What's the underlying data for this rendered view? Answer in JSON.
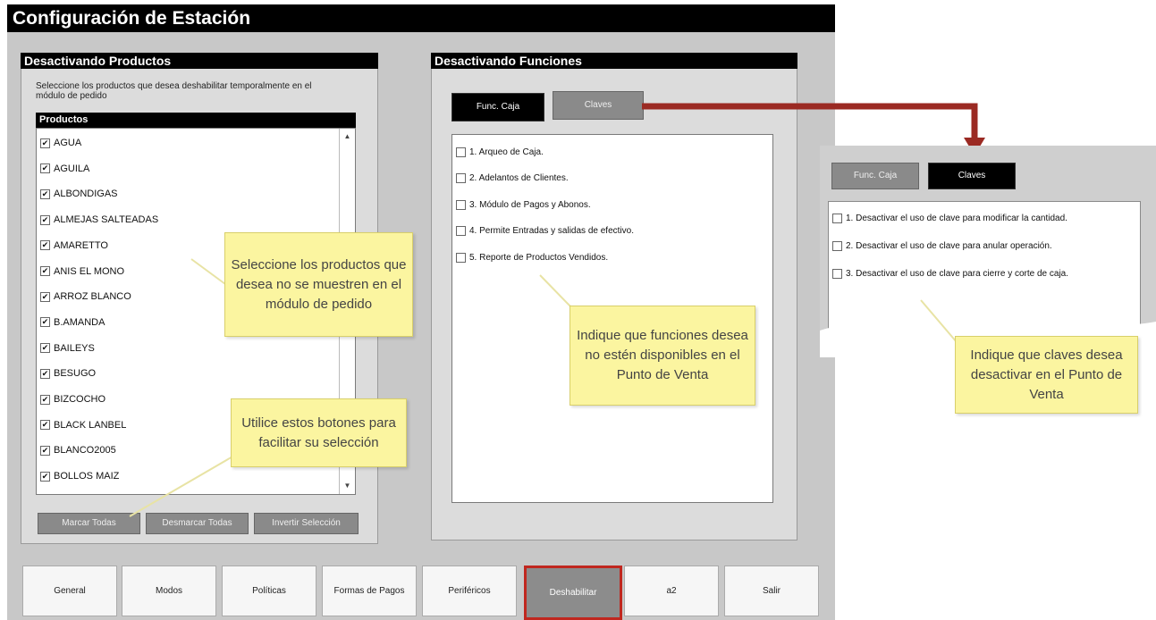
{
  "window": {
    "title": "Configuración de Estación"
  },
  "products_panel": {
    "header": "Desactivando Productos",
    "description": "Seleccione los productos que desea deshabilitar temporalmente en el módulo de pedido",
    "list_header": "Productos",
    "items": [
      "AGUA",
      "AGUILA",
      "ALBONDIGAS",
      "ALMEJAS SALTEADAS",
      "AMARETTO",
      "ANIS EL MONO",
      "ARROZ BLANCO",
      "B.AMANDA",
      "BAILEYS",
      "BESUGO",
      "BIZCOCHO",
      "BLACK LANBEL",
      "BLANCO2005",
      "BOLLOS MAIZ"
    ],
    "buttons": {
      "mark_all": "Marcar Todas",
      "unmark_all": "Desmarcar Todas",
      "invert": "Invertir Selección"
    }
  },
  "functions_panel": {
    "header": "Desactivando Funciones",
    "tab_caja": "Func. Caja",
    "tab_claves": "Claves",
    "items": [
      "1. Arqueo de Caja.",
      "2. Adelantos de Clientes.",
      "3. Módulo de Pagos y Abonos.",
      "4. Permite Entradas y salidas de efectivo.",
      "5. Reporte de Productos Vendidos."
    ]
  },
  "inset": {
    "tab_caja": "Func. Caja",
    "tab_claves": "Claves",
    "items": [
      "1. Desactivar el uso de clave para modificar la cantidad.",
      "2. Desactivar el uso de clave para anular operación.",
      "3. Desactivar el uso de clave para cierre y corte de caja."
    ]
  },
  "notes": {
    "products": "Seleccione los productos que desea no se muestren en el módulo de pedido",
    "buttons": "Utilice estos botones para facilitar su selección",
    "functions": "Indique que funciones desea no estén disponibles en el Punto de Venta",
    "keys": "Indique que claves desea desactivar en el Punto de Venta"
  },
  "bottom_tabs": [
    "General",
    "Modos",
    "Políticas",
    "Formas de Pagos",
    "Periféricos",
    "Deshabilitar",
    "a2",
    "Salir"
  ],
  "colors": {
    "accent_red": "#c0271f",
    "arrow_red": "#9b2a23",
    "note_yellow": "#fbf5a0"
  }
}
